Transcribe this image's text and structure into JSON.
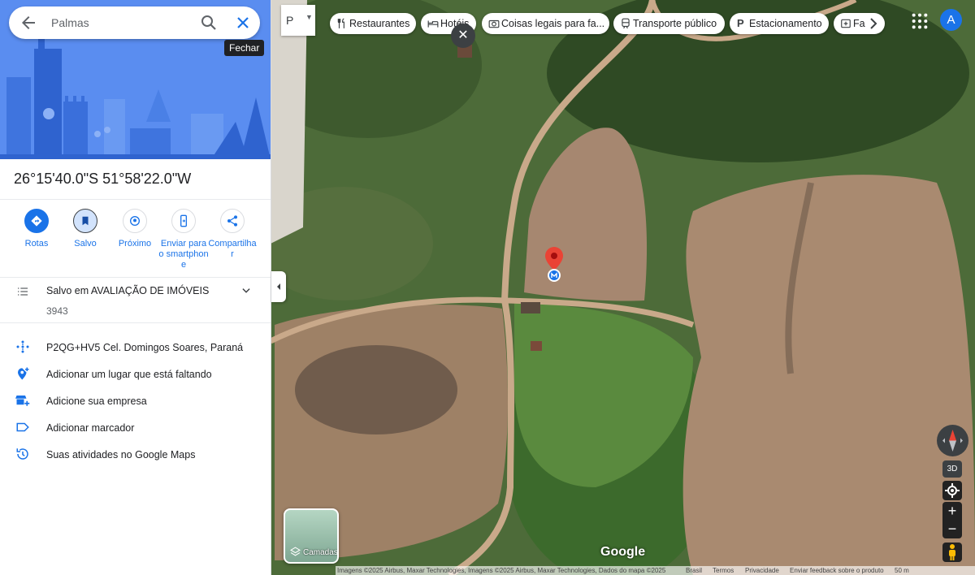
{
  "search": {
    "query": "Palmas",
    "close_tooltip": "Fechar"
  },
  "place": {
    "coordinates": "26°15'40.0\"S 51°58'22.0\"W"
  },
  "actions": [
    {
      "label": "Rotas",
      "icon": "directions-icon"
    },
    {
      "label": "Salvo",
      "icon": "bookmark-icon"
    },
    {
      "label": "Próximo",
      "icon": "nearby-icon"
    },
    {
      "label": "Enviar para o smartphone",
      "icon": "send-to-phone-icon"
    },
    {
      "label": "Compartilhar",
      "icon": "share-icon"
    }
  ],
  "saved": {
    "label": "Salvo em AVALIAÇÃO DE IMÓVEIS",
    "count": "3943"
  },
  "info": [
    {
      "label": "P2QG+HV5 Cel. Domingos Soares, Paraná",
      "icon": "plus-code-icon"
    },
    {
      "label": "Adicionar um lugar que está faltando",
      "icon": "add-place-icon"
    },
    {
      "label": "Adicione sua empresa",
      "icon": "add-business-icon"
    },
    {
      "label": "Adicionar marcador",
      "icon": "label-icon"
    },
    {
      "label": "Suas atividades no Google Maps",
      "icon": "history-icon"
    }
  ],
  "map": {
    "mode_label": "P",
    "chips": [
      {
        "label": "Restaurantes",
        "icon": "restaurant-icon"
      },
      {
        "label": "Hotéis",
        "icon": "hotel-icon"
      },
      {
        "label": "Coisas legais para fa...",
        "icon": "camera-icon"
      },
      {
        "label": "Transporte público",
        "icon": "transit-icon"
      },
      {
        "label": "Estacionamento",
        "icon": "parking-icon"
      },
      {
        "label": "Fa",
        "icon": "pharmacy-icon"
      }
    ],
    "avatar_letter": "A",
    "layers_label": "Camadas",
    "google_logo": "Google",
    "btn_3d": "3D",
    "zoom_in": "+",
    "zoom_out": "−",
    "footer": {
      "attribution": "Imagens ©2025 Airbus, Maxar Technologies, Imagens ©2025 Airbus, Maxar Technologies, Dados do mapa ©2025",
      "country": "Brasil",
      "terms": "Termos",
      "privacy": "Privacidade",
      "feedback": "Enviar feedback sobre o produto",
      "scale": "50 m"
    }
  }
}
